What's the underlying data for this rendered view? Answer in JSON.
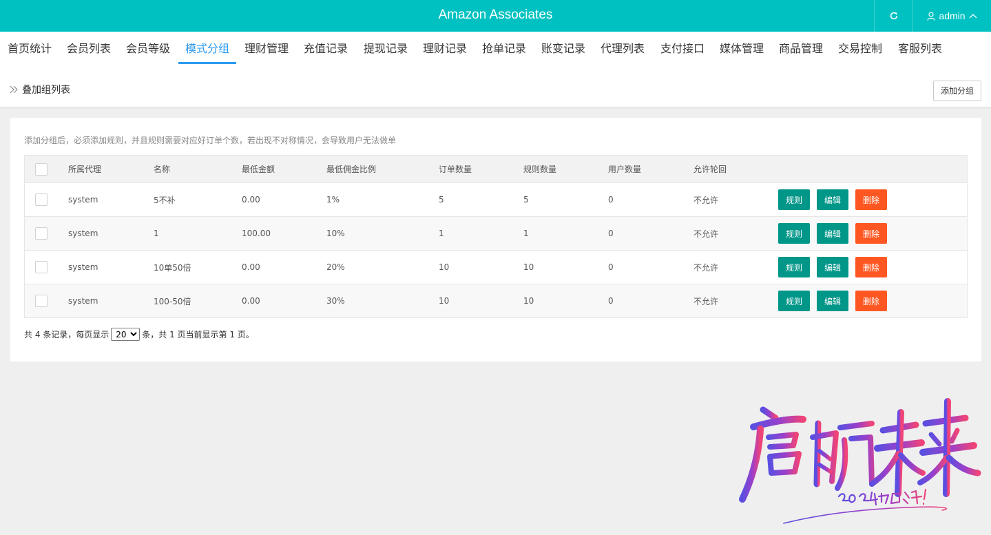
{
  "header": {
    "title": "Amazon Associates",
    "user": "admin"
  },
  "nav": [
    "首页统计",
    "会员列表",
    "会员等级",
    "模式分组",
    "理财管理",
    "充值记录",
    "提现记录",
    "理财记录",
    "抢单记录",
    "账变记录",
    "代理列表",
    "支付接口",
    "媒体管理",
    "商品管理",
    "交易控制",
    "客服列表"
  ],
  "active_nav_index": 3,
  "breadcrumb": {
    "title": "叠加组列表",
    "add_button": "添加分组"
  },
  "tip": "添加分组后，必须添加规则，并且规则需要对应好订单个数，若出现不对称情况，会导致用户无法做单",
  "table": {
    "headers": [
      "所属代理",
      "名称",
      "最低金额",
      "最低佣金比例",
      "订单数量",
      "规则数量",
      "用户数量",
      "允许轮回"
    ],
    "rows": [
      [
        "system",
        "5不补",
        "0.00",
        "1%",
        "5",
        "5",
        "0",
        "不允许"
      ],
      [
        "system",
        "1",
        "100.00",
        "10%",
        "1",
        "1",
        "0",
        "不允许"
      ],
      [
        "system",
        "10单50倍",
        "0.00",
        "20%",
        "10",
        "10",
        "0",
        "不允许"
      ],
      [
        "system",
        "100-50倍",
        "0.00",
        "30%",
        "10",
        "10",
        "0",
        "不允许"
      ]
    ],
    "actions": {
      "rules": "规则",
      "edit": "编辑",
      "delete": "删除"
    }
  },
  "pager": {
    "prefix": "共 4 条记录，每页显示",
    "page_size": "20",
    "suffix": "条，共 1 页当前显示第 1 页。"
  },
  "watermark": {
    "title": "启航未来",
    "subtitle": "2024加油!"
  },
  "colors": {
    "header": "#00c1c1",
    "active_nav": "#2d9bef",
    "green_button": "#009688",
    "red_button": "#ff5722"
  }
}
